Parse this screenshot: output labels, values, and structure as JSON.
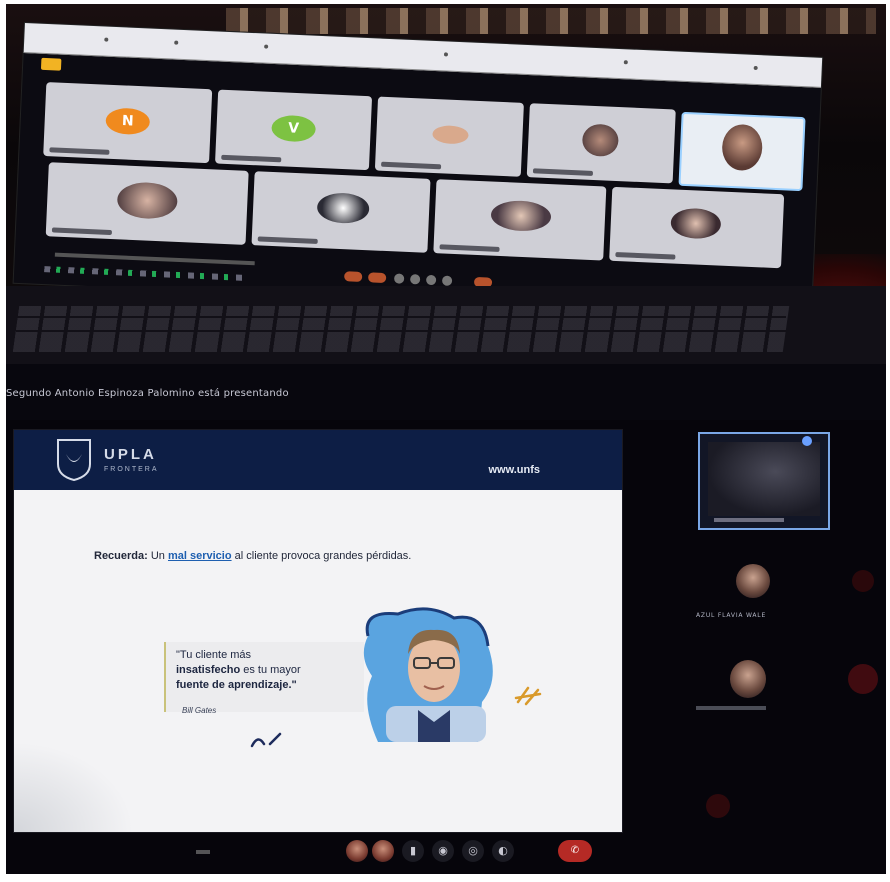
{
  "laptop": {
    "tiles": [
      {
        "letter": "N",
        "color": "#f08a1e"
      },
      {
        "letter": "V",
        "color": "#7dc242"
      }
    ],
    "toolbar_buttons": [
      "mic-icon",
      "camera-icon",
      "share-icon",
      "chat-icon",
      "people-icon",
      "more-icon",
      "end-call-icon"
    ]
  },
  "monitor": {
    "presenting_banner": "Segundo Antonio Espinoza Palomino está presentando"
  },
  "slide": {
    "logo_text": "UPLA",
    "logo_sub": "FRONTERA",
    "url": "www.unfs",
    "recuerda_label": "Recuerda:",
    "recuerda_prefix": "Un",
    "recuerda_link": "mal servicio",
    "recuerda_suffix": "al cliente provoca grandes pérdidas.",
    "quote_line1": "\"Tu cliente más",
    "quote_bold": "insatisfecho",
    "quote_line2_rest": " es tu mayor",
    "quote_line3": "fuente de aprendizaje.\"",
    "quote_author": "Bill Gates"
  },
  "sidebar": {
    "participant_name": "AZUL FLAVIA WALE"
  },
  "colors": {
    "slide_header": "#0d1e45",
    "link_blue": "#1e5fb0",
    "end_call_red": "#b52a25",
    "active_tile_border": "#7aa7e6"
  }
}
